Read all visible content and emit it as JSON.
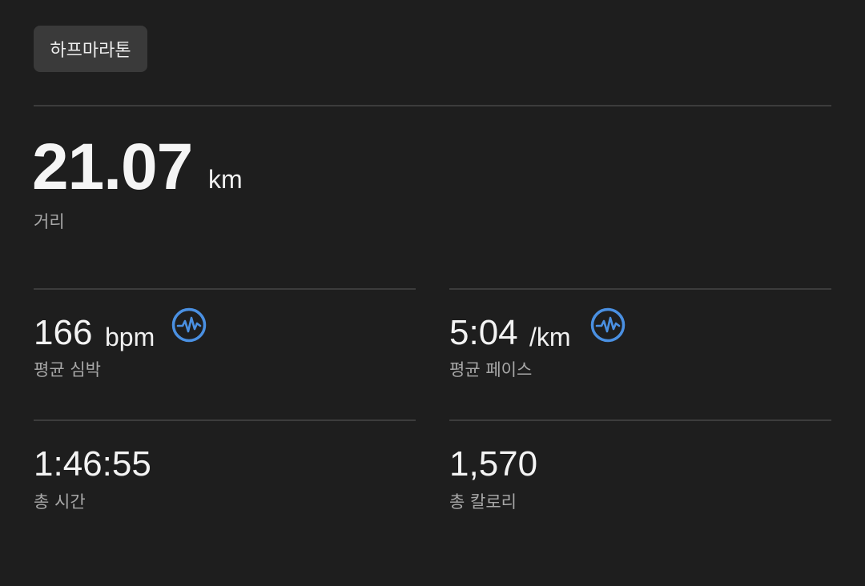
{
  "workout": {
    "type_label": "하프마라톤"
  },
  "distance": {
    "value": "21.07",
    "unit": "km",
    "label": "거리"
  },
  "stats": {
    "heart_rate": {
      "value": "166",
      "unit": "bpm",
      "label": "평균 심박",
      "icon": "heart-rate-icon"
    },
    "pace": {
      "value": "5:04",
      "unit": "/km",
      "label": "평균 페이스",
      "icon": "heart-rate-icon"
    },
    "time": {
      "value": "1:46:55",
      "label": "총 시간"
    },
    "calories": {
      "value": "1,570",
      "label": "총 칼로리"
    }
  },
  "colors": {
    "background": "#1e1e1e",
    "chip": "#3a3a3a",
    "accent": "#4a90e2",
    "divider": "#3c3c3c"
  }
}
